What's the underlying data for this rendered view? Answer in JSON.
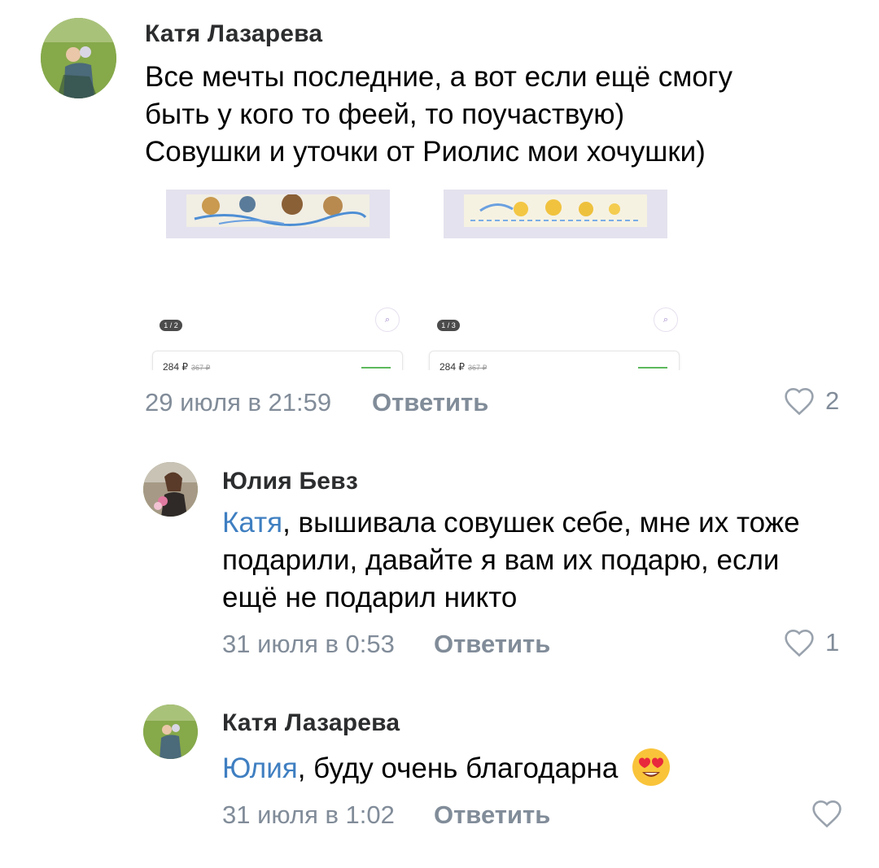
{
  "comments": [
    {
      "author": "Катя Лазарева",
      "text_lines": [
        "Все мечты последние, а вот если ещё смогу",
        "быть у кого то феей, то поучаствую)",
        "Совушки и уточки от Риолис мои хочушки)"
      ],
      "date": "29 июля в 21:59",
      "reply_label": "Ответить",
      "likes": "2",
      "attachments": [
        {
          "badge": "1 / 2",
          "price": "284 ₽",
          "old_price": "367 ₽"
        },
        {
          "badge": "1 / 3",
          "price": "284 ₽",
          "old_price": "367 ₽"
        }
      ]
    },
    {
      "author": "Юлия Бевз",
      "mention": "Катя",
      "text_lines": [
        ", вышивала совушек себе, мне их тоже",
        "подарили, давайте я вам их подарю, если",
        "ещё не подарил никто"
      ],
      "date": "31 июля в 0:53",
      "reply_label": "Ответить",
      "likes": "1"
    },
    {
      "author": "Катя Лазарева",
      "mention": "Юлия",
      "text": ", буду очень благодарна",
      "emoji": "😍",
      "date": "31 июля в 1:02",
      "reply_label": "Ответить",
      "likes": ""
    }
  ],
  "icons": {
    "like": "heart-outline-icon",
    "zoom": "magnifier-icon"
  },
  "colors": {
    "mention": "#3f7fc1",
    "meta": "#818c99",
    "name": "#2c2d2e"
  }
}
